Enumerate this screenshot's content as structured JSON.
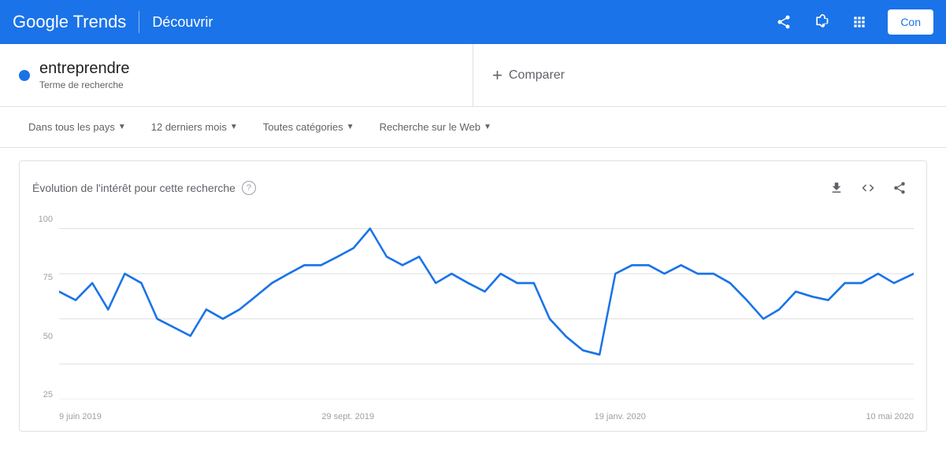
{
  "header": {
    "logo": "Google Trends",
    "title": "Découvrir",
    "connect_label": "Con",
    "share_icon": "share",
    "flag_icon": "flag",
    "apps_icon": "apps"
  },
  "search": {
    "term": "entreprendre",
    "term_label": "Terme de recherche",
    "compare_label": "Comparer"
  },
  "filters": {
    "country": "Dans tous les pays",
    "period": "12 derniers mois",
    "category": "Toutes catégories",
    "type": "Recherche sur le Web"
  },
  "chart": {
    "title": "Évolution de l'intérêt pour cette recherche",
    "x_labels": [
      "9 juin 2019",
      "29 sept. 2019",
      "19 janv. 2020",
      "10 mai 2020"
    ],
    "y_labels": [
      "100",
      "75",
      "50",
      "25"
    ],
    "download_icon": "download",
    "embed_icon": "code",
    "share_icon": "share"
  }
}
